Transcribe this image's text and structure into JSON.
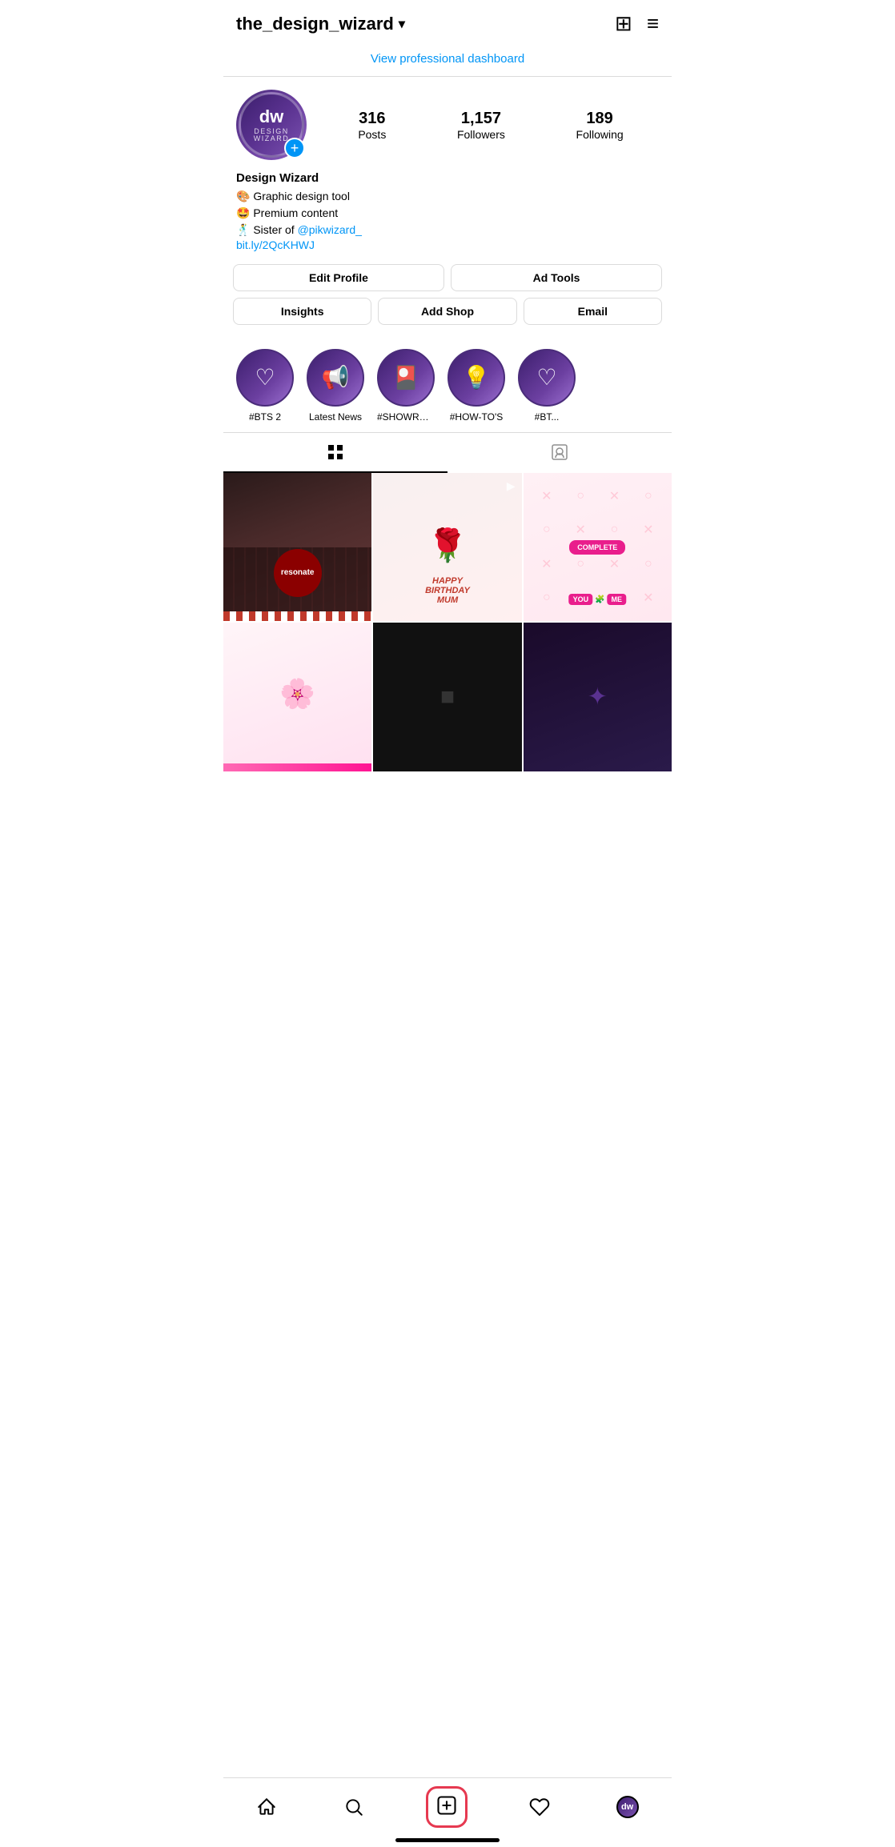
{
  "header": {
    "username": "the_design_wizard",
    "chevron": "▾",
    "add_icon": "⊞",
    "menu_icon": "≡"
  },
  "pro_dashboard": {
    "label": "View professional dashboard"
  },
  "profile": {
    "avatar_initials": "dw",
    "avatar_subtitle": "DESIGN WIZARD",
    "stats": [
      {
        "number": "316",
        "label": "Posts"
      },
      {
        "number": "1,157",
        "label": "Followers"
      },
      {
        "number": "189",
        "label": "Following"
      }
    ],
    "name": "Design Wizard",
    "bio_lines": [
      "🎨 Graphic design tool",
      "🤩 Premium content",
      "🕺 Sister of @pikwizard_"
    ],
    "link": "bit.ly/2QcKHWJ",
    "link_href": "#"
  },
  "buttons": {
    "row1": [
      {
        "label": "Edit Profile"
      },
      {
        "label": "Ad Tools"
      }
    ],
    "row2": [
      {
        "label": "Insights"
      },
      {
        "label": "Add Shop"
      },
      {
        "label": "Email"
      }
    ]
  },
  "highlights": [
    {
      "label": "#BTS 2",
      "icon": "♡"
    },
    {
      "label": "Latest News",
      "icon": "📢"
    },
    {
      "label": "#SHOWREEL",
      "icon": "🎴"
    },
    {
      "label": "#HOW-TO'S",
      "icon": "💡"
    },
    {
      "label": "#BT...",
      "icon": "♡"
    }
  ],
  "tabs": [
    {
      "label": "grid",
      "active": true
    },
    {
      "label": "tagged",
      "active": false
    }
  ],
  "posts": [
    {
      "bg": "post-bg-1",
      "type": "piano"
    },
    {
      "bg": "post-bg-2",
      "type": "birthday"
    },
    {
      "bg": "post-bg-3",
      "type": "xo"
    },
    {
      "bg": "post-bg-4",
      "type": "flower"
    },
    {
      "bg": "post-bg-5",
      "type": "dark"
    },
    {
      "bg": "post-bg-6",
      "type": "purple"
    }
  ],
  "bottom_nav": {
    "items": [
      {
        "icon": "🏠",
        "name": "home"
      },
      {
        "icon": "🔍",
        "name": "search"
      },
      {
        "icon": "⊞",
        "name": "create"
      },
      {
        "icon": "♡",
        "name": "activity"
      },
      {
        "icon": "dw",
        "name": "profile"
      }
    ]
  }
}
